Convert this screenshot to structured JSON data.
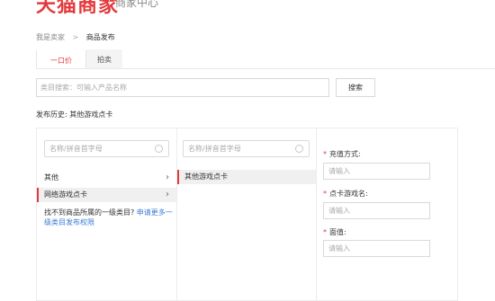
{
  "header": {
    "logo_text": "天猫商家",
    "logo_sub": "商家中心"
  },
  "breadcrumb": {
    "root": "我是卖家",
    "separator": ">",
    "current": "商品发布"
  },
  "tabs": [
    {
      "label": "一口价",
      "active": true
    },
    {
      "label": "拍卖",
      "active": false
    }
  ],
  "search": {
    "placeholder": "类目搜索：可输入产品名称",
    "button": "搜索"
  },
  "history": {
    "label": "发布历史:",
    "value": "其他游戏点卡"
  },
  "column1": {
    "filter_placeholder": "名称/拼音首字母",
    "items": [
      {
        "label": "其他",
        "selected": false
      },
      {
        "label": "网络游戏点卡",
        "selected": true
      }
    ],
    "notfound_text": "找不到商品所属的一级类目?",
    "notfound_link": "申请更多一级类目发布权限"
  },
  "column2": {
    "filter_placeholder": "名称/拼音首字母",
    "items": [
      {
        "label": "其他游戏点卡",
        "selected": true
      }
    ]
  },
  "column3": {
    "fields": [
      {
        "label": "充值方式:",
        "placeholder": "请输入"
      },
      {
        "label": "点卡游戏名:",
        "placeholder": "请输入"
      },
      {
        "label": "面值:",
        "placeholder": "请输入"
      }
    ]
  },
  "colors": {
    "accent": "#e4393c",
    "link": "#3c7bd6"
  }
}
